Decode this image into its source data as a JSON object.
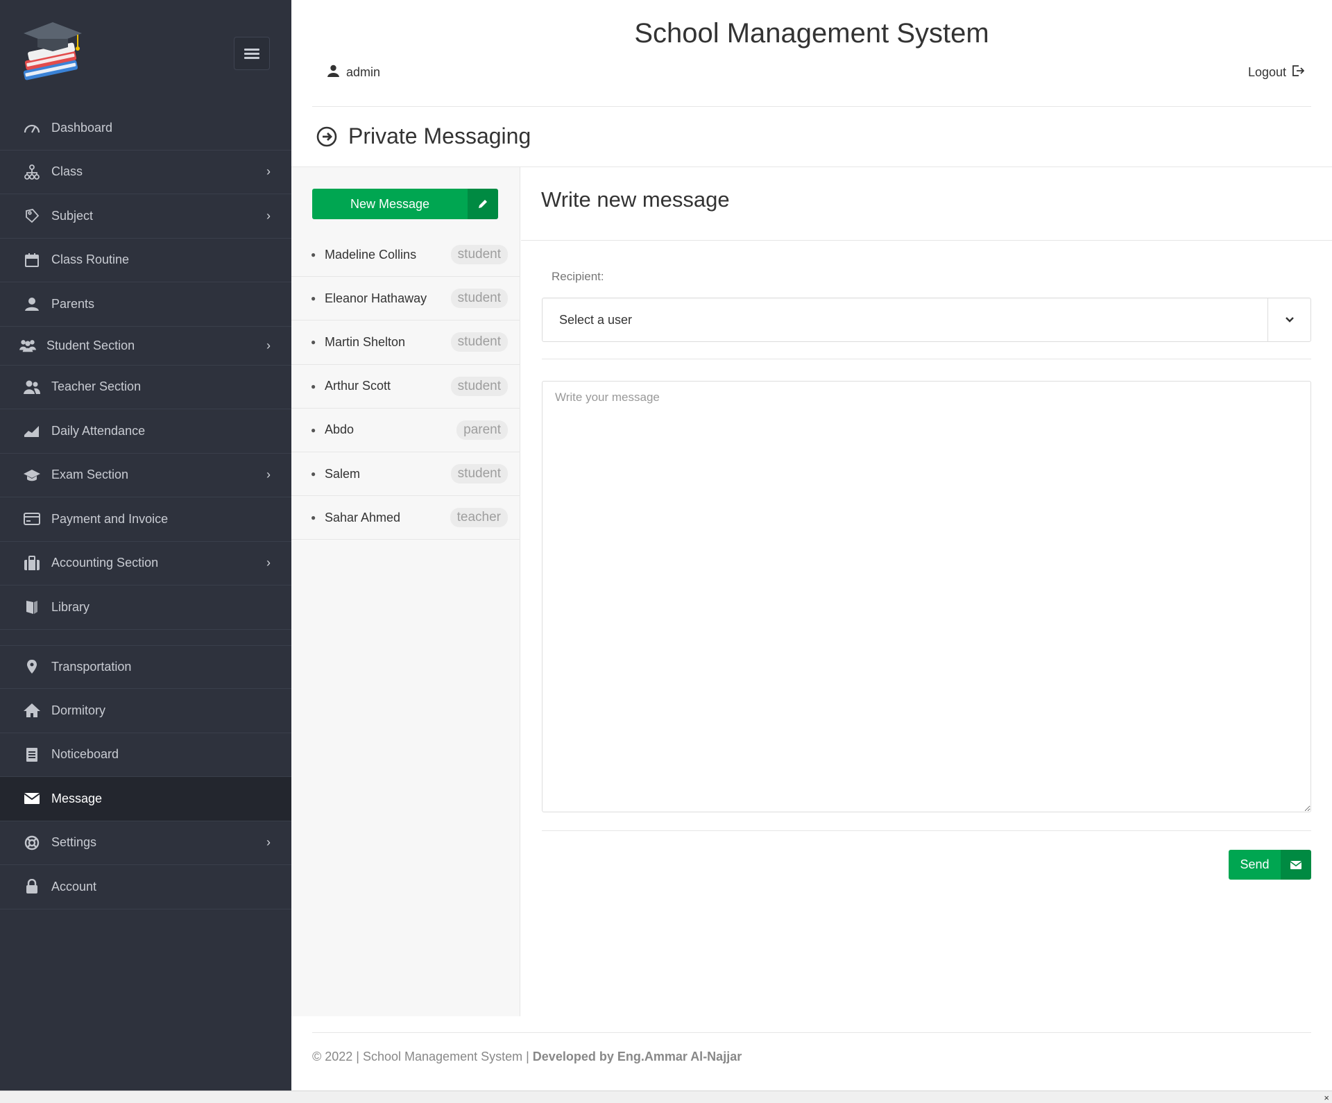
{
  "header": {
    "title": "School Management System",
    "user": "admin",
    "logout": "Logout"
  },
  "page": {
    "title": "Private Messaging"
  },
  "sidebar": {
    "items": [
      {
        "label": "Dashboard",
        "icon": "dashboard-icon",
        "has_submenu": false
      },
      {
        "label": "Class",
        "icon": "sitemap-icon",
        "has_submenu": true
      },
      {
        "label": "Subject",
        "icon": "book-tag-icon",
        "has_submenu": true
      },
      {
        "label": "Class Routine",
        "icon": "calendar-icon",
        "has_submenu": false
      },
      {
        "label": "Parents",
        "icon": "user-icon",
        "has_submenu": false
      },
      {
        "label": "Student Section",
        "icon": "users-group-icon",
        "has_submenu": true
      },
      {
        "label": "Teacher Section",
        "icon": "teacher-icon",
        "has_submenu": false
      },
      {
        "label": "Daily Attendance",
        "icon": "area-chart-icon",
        "has_submenu": false
      },
      {
        "label": "Exam Section",
        "icon": "graduation-cap-icon",
        "has_submenu": true
      },
      {
        "label": "Payment and Invoice",
        "icon": "credit-card-icon",
        "has_submenu": false
      },
      {
        "label": "Accounting Section",
        "icon": "suitcase-icon",
        "has_submenu": true
      },
      {
        "label": "Library",
        "icon": "book-icon",
        "has_submenu": false
      },
      {
        "label": "Transportation",
        "icon": "map-marker-icon",
        "has_submenu": false
      },
      {
        "label": "Dormitory",
        "icon": "home-icon",
        "has_submenu": false
      },
      {
        "label": "Noticeboard",
        "icon": "document-icon",
        "has_submenu": false
      },
      {
        "label": "Message",
        "icon": "envelope-icon",
        "has_submenu": false,
        "active": true
      },
      {
        "label": "Settings",
        "icon": "lifebuoy-icon",
        "has_submenu": true
      },
      {
        "label": "Account",
        "icon": "lock-icon",
        "has_submenu": false
      }
    ]
  },
  "messaging": {
    "new_message_label": "New Message",
    "contacts": [
      {
        "name": "Madeline Collins",
        "role": "student"
      },
      {
        "name": "Eleanor Hathaway",
        "role": "student"
      },
      {
        "name": "Martin Shelton",
        "role": "student"
      },
      {
        "name": "Arthur Scott",
        "role": "student"
      },
      {
        "name": "Abdo",
        "role": "parent"
      },
      {
        "name": "Salem",
        "role": "student"
      },
      {
        "name": "Sahar Ahmed",
        "role": "teacher"
      }
    ],
    "compose": {
      "title": "Write new message",
      "recipient_label": "Recipient:",
      "recipient_value": "Select a user",
      "message_placeholder": "Write your message",
      "send_label": "Send"
    }
  },
  "footer": {
    "copyright": "© 2022 | School Management System |",
    "developer": "Developed by Eng.Ammar Al-Najjar"
  },
  "colors": {
    "sidebar_bg": "#2e323d",
    "accent_green": "#00a651",
    "accent_green_dark": "#008a42"
  }
}
